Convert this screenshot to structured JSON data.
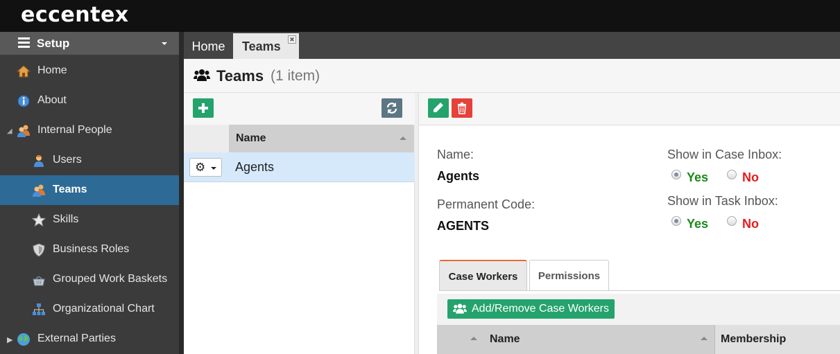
{
  "brand": {
    "logo": "eccentex"
  },
  "sidebar": {
    "section_label": "Setup",
    "items": [
      {
        "label": "Home",
        "icon": "house-icon"
      },
      {
        "label": "About",
        "icon": "info-icon"
      },
      {
        "label": "Internal People",
        "icon": "people-icon"
      },
      {
        "label": "Users",
        "icon": "user-icon"
      },
      {
        "label": "Teams",
        "icon": "team-icon",
        "active": true
      },
      {
        "label": "Skills",
        "icon": "star-icon"
      },
      {
        "label": "Business Roles",
        "icon": "shield-icon"
      },
      {
        "label": "Grouped Work Baskets",
        "icon": "basket-icon"
      },
      {
        "label": "Organizational Chart",
        "icon": "org-chart-icon"
      },
      {
        "label": "External Parties",
        "icon": "globe-icon"
      }
    ]
  },
  "tabs": [
    {
      "label": "Home"
    },
    {
      "label": "Teams",
      "active": true,
      "close": "✖"
    }
  ],
  "page": {
    "title": "Teams",
    "count": "(1 item)"
  },
  "list": {
    "columns": {
      "name": "Name"
    },
    "rows": [
      {
        "name": "Agents"
      }
    ]
  },
  "detail": {
    "name_label": "Name:",
    "name_value": "Agents",
    "code_label": "Permanent Code:",
    "code_value": "AGENTS",
    "case_inbox_label": "Show in Case Inbox:",
    "task_inbox_label": "Show in Task Inbox:",
    "yes": "Yes",
    "no": "No",
    "case_inbox_value": "Yes",
    "task_inbox_value": "Yes"
  },
  "subtabs": [
    {
      "label": "Case Workers",
      "active": true
    },
    {
      "label": "Permissions"
    }
  ],
  "case_workers": {
    "add_button": "Add/Remove Case Workers",
    "columns": {
      "name": "Name",
      "membership": "Membership"
    }
  },
  "colors": {
    "accent": "#2d6a96",
    "green": "#24a36c",
    "red": "#e6413a",
    "yes": "#1a8a1a",
    "no": "#e61c1c"
  }
}
